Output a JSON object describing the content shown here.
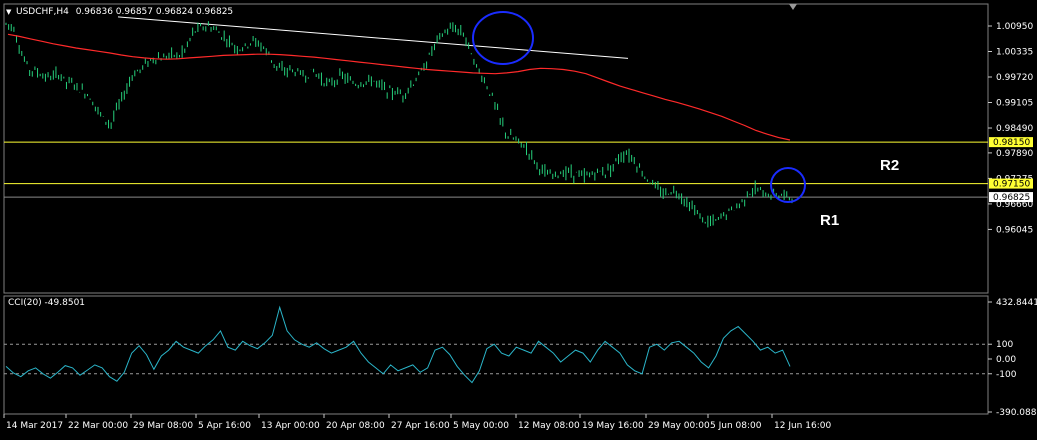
{
  "window": {
    "symbol_label": "USDCHF,H4",
    "ohlc": "0.96836 0.96857 0.96824 0.96825",
    "indicator_label": "CCI(20) -49.8501"
  },
  "colors": {
    "background": "#000000",
    "bars": "#26d07c",
    "ma": "#ff2a2a",
    "trendline": "#ffffff",
    "hline": "#ffff33",
    "circle": "#1a2cff",
    "cci": "#2bb5c9",
    "axis": "#c8c8c8"
  },
  "chart_data": [
    {
      "type": "line",
      "title": "USDCHF,H4",
      "x_ticks": [
        "14 Mar 2017",
        "22 Mar 00:00",
        "29 Mar 08:00",
        "5 Apr 16:00",
        "13 Apr 00:00",
        "20 Apr 08:00",
        "27 Apr 16:00",
        "5 May 00:00",
        "12 May 08:00",
        "19 May 16:00",
        "29 May 00:00",
        "5 Jun 08:00",
        "12 Jun 16:00"
      ],
      "y_ticks": [
        1.0095,
        1.00335,
        0.9972,
        0.99105,
        0.9849,
        0.9789,
        0.97275,
        0.9666,
        0.96045
      ],
      "ylim": [
        0.9587,
        1.0122
      ],
      "series": [
        {
          "style": "ohlc-bars",
          "close_path": [
            1.01,
            1.0095,
            1.003,
            0.999,
            0.9985,
            0.9975,
            0.997,
            0.998,
            0.996,
            0.9955,
            0.994,
            0.993,
            0.99,
            0.987,
            0.986,
            0.99,
            0.994,
            0.998,
            0.999,
            1.001,
            1.002,
            1.0015,
            1.003,
            1.002,
            1.004,
            1.008,
            1.009,
            1.0095,
            1.0085,
            1.007,
            1.0055,
            1.004,
            1.0045,
            1.006,
            1.005,
            1.003,
            1.0,
            0.9985,
            0.999,
            0.998,
            0.9975,
            0.9985,
            0.997,
            0.9955,
            0.9965,
            0.9975,
            0.996,
            0.9955,
            0.996,
            0.9965,
            0.995,
            0.994,
            0.9935,
            0.993,
            0.995,
            0.997,
            1.0,
            1.004,
            1.007,
            1.0085,
            1.009,
            1.008,
            1.004,
            0.999,
            0.996,
            0.992,
            0.987,
            0.983,
            0.982,
            0.981,
            0.979,
            0.976,
            0.974,
            0.973,
            0.974,
            0.9745,
            0.974,
            0.973,
            0.9735,
            0.9745,
            0.974,
            0.976,
            0.978,
            0.979,
            0.977,
            0.974,
            0.972,
            0.97,
            0.969,
            0.97,
            0.969,
            0.967,
            0.965,
            0.963,
            0.962,
            0.9625,
            0.964,
            0.965,
            0.9665,
            0.969,
            0.97,
            0.9695,
            0.9685,
            0.969,
            0.9685,
            0.96825
          ]
        },
        {
          "style": "moving-average",
          "values": [
            1.0075,
            1.007,
            1.0064,
            1.0058,
            1.0052,
            1.0047,
            1.0042,
            1.0038,
            1.0034,
            1.003,
            1.0025,
            1.0021,
            1.0018,
            1.0016,
            1.0015,
            1.0016,
            1.0018,
            1.002,
            1.0022,
            1.0024,
            1.0025,
            1.0026,
            1.0027,
            1.0027,
            1.0026,
            1.0024,
            1.0022,
            1.002,
            1.0017,
            1.0014,
            1.0011,
            1.0008,
            1.0005,
            1.0002,
            0.9999,
            0.9996,
            0.9993,
            0.999,
            0.9988,
            0.9986,
            0.9984,
            0.9982,
            0.9981,
            0.998,
            0.9982,
            0.9985,
            0.999,
            0.9993,
            0.9992,
            0.999,
            0.9986,
            0.998,
            0.997,
            0.996,
            0.995,
            0.9942,
            0.9934,
            0.9926,
            0.9918,
            0.9911,
            0.9903,
            0.9895,
            0.9886,
            0.9877,
            0.9866,
            0.9855,
            0.9843,
            0.9834,
            0.9826,
            0.982
          ]
        },
        {
          "style": "trendline",
          "points": [
            [
              0,
              1.0117
            ],
            [
              82,
              1.0017
            ]
          ]
        }
      ],
      "annotations": [
        {
          "kind": "hline",
          "label": "R2",
          "value": 0.9815,
          "price_tag": "0.98150"
        },
        {
          "kind": "hline",
          "label": "R1",
          "value": 0.9715,
          "price_tag": "0.97150"
        },
        {
          "kind": "current-price",
          "value": 0.96825,
          "price_tag": "0.96825"
        },
        {
          "kind": "circle",
          "around": "May double-top"
        },
        {
          "kind": "circle",
          "around": "moving average near R2"
        }
      ]
    },
    {
      "type": "line",
      "title": "CCI(20) -49.8501",
      "y_ticks": [
        432.8441,
        100,
        0.0,
        -100,
        -390.0885
      ],
      "ylim": [
        -390.0885,
        432.8441
      ],
      "levels": [
        100,
        -100
      ],
      "series": [
        {
          "style": "cci",
          "values": [
            -50,
            -95,
            -120,
            -80,
            -60,
            -100,
            -130,
            -90,
            -45,
            -60,
            -110,
            -75,
            -40,
            -60,
            -120,
            -150,
            -90,
            40,
            90,
            30,
            -70,
            20,
            60,
            120,
            80,
            60,
            40,
            90,
            130,
            190,
            80,
            60,
            120,
            90,
            70,
            110,
            160,
            350,
            190,
            130,
            100,
            80,
            110,
            70,
            40,
            60,
            80,
            120,
            40,
            -20,
            -60,
            -100,
            -40,
            -80,
            -60,
            -40,
            -90,
            -60,
            60,
            80,
            30,
            -50,
            -110,
            -160,
            -80,
            70,
            100,
            40,
            20,
            80,
            60,
            40,
            120,
            80,
            40,
            -20,
            20,
            60,
            40,
            -20,
            60,
            120,
            80,
            40,
            -40,
            -80,
            -100,
            80,
            100,
            60,
            110,
            120,
            80,
            40,
            -20,
            -60,
            20,
            140,
            190,
            220,
            170,
            120,
            60,
            80,
            40,
            60,
            -49.85
          ]
        }
      ]
    }
  ]
}
